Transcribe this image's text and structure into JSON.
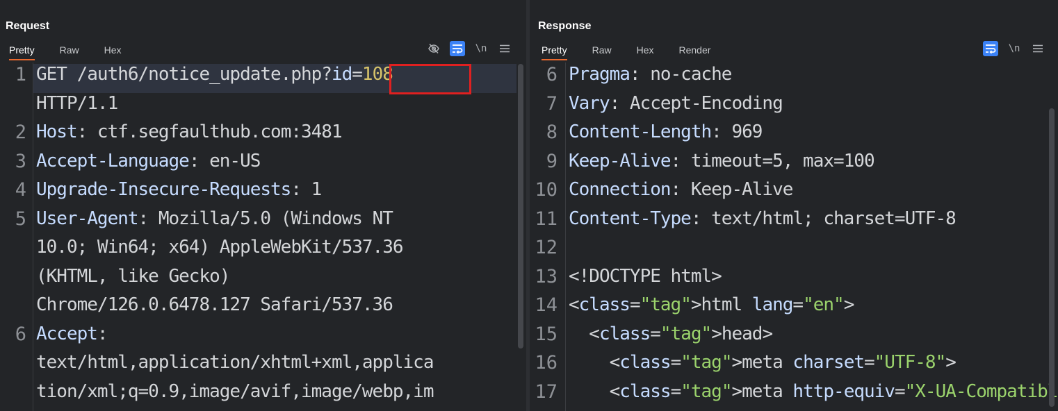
{
  "request": {
    "title": "Request",
    "tabs": [
      "Pretty",
      "Raw",
      "Hex"
    ],
    "active_tab": "Pretty",
    "tools": {
      "hide_icon": "eye-off-icon",
      "wrap_icon": "wrap-icon",
      "newline_label": "\\n",
      "menu_icon": "menu-icon"
    },
    "lines": [
      {
        "n": "1",
        "text": "GET /auth6/notice_update.php?id=108"
      },
      {
        "n": "",
        "text": "HTTP/1.1"
      },
      {
        "n": "2",
        "text": "Host: ctf.segfaulthub.com:3481"
      },
      {
        "n": "3",
        "text": "Accept-Language: en-US"
      },
      {
        "n": "4",
        "text": "Upgrade-Insecure-Requests: 1"
      },
      {
        "n": "5",
        "text": "User-Agent: Mozilla/5.0 (Windows NT"
      },
      {
        "n": "",
        "text": "10.0; Win64; x64) AppleWebKit/537.36"
      },
      {
        "n": "",
        "text": "(KHTML, like Gecko)"
      },
      {
        "n": "",
        "text": "Chrome/126.0.6478.127 Safari/537.36"
      },
      {
        "n": "6",
        "text": "Accept:"
      },
      {
        "n": "",
        "text": "text/html,application/xhtml+xml,applica"
      },
      {
        "n": "",
        "text": "tion/xml;q=0.9,image/avif,image/webp,im"
      }
    ],
    "highlight_param": "id=108"
  },
  "response": {
    "title": "Response",
    "tabs": [
      "Pretty",
      "Raw",
      "Hex",
      "Render"
    ],
    "active_tab": "Pretty",
    "tools": {
      "wrap_icon": "wrap-icon",
      "newline_label": "\\n",
      "menu_icon": "menu-icon"
    },
    "lines": [
      {
        "n": "6",
        "text": "Pragma: no-cache"
      },
      {
        "n": "7",
        "text": "Vary: Accept-Encoding"
      },
      {
        "n": "8",
        "text": "Content-Length: 969"
      },
      {
        "n": "9",
        "text": "Keep-Alive: timeout=5, max=100"
      },
      {
        "n": "10",
        "text": "Connection: Keep-Alive"
      },
      {
        "n": "11",
        "text": "Content-Type: text/html; charset=UTF-8"
      },
      {
        "n": "12",
        "text": ""
      },
      {
        "n": "13",
        "text": "<!DOCTYPE html>"
      },
      {
        "n": "14",
        "text": "<html lang=\"en\">"
      },
      {
        "n": "15",
        "text": "  <head>"
      },
      {
        "n": "16",
        "text": "    <meta charset=\"UTF-8\">"
      },
      {
        "n": "17",
        "text": "    <meta http-equiv=\"X-UA-Compatible\""
      }
    ]
  },
  "layout_toggle": {
    "icons": [
      "split-horizontal-icon",
      "split-vertical-icon",
      "single-pane-icon"
    ],
    "active": "split-horizontal-icon"
  },
  "colors": {
    "accent": "#3b82f6",
    "tab_underline": "#e8692e",
    "highlight_box": "#e02020"
  }
}
